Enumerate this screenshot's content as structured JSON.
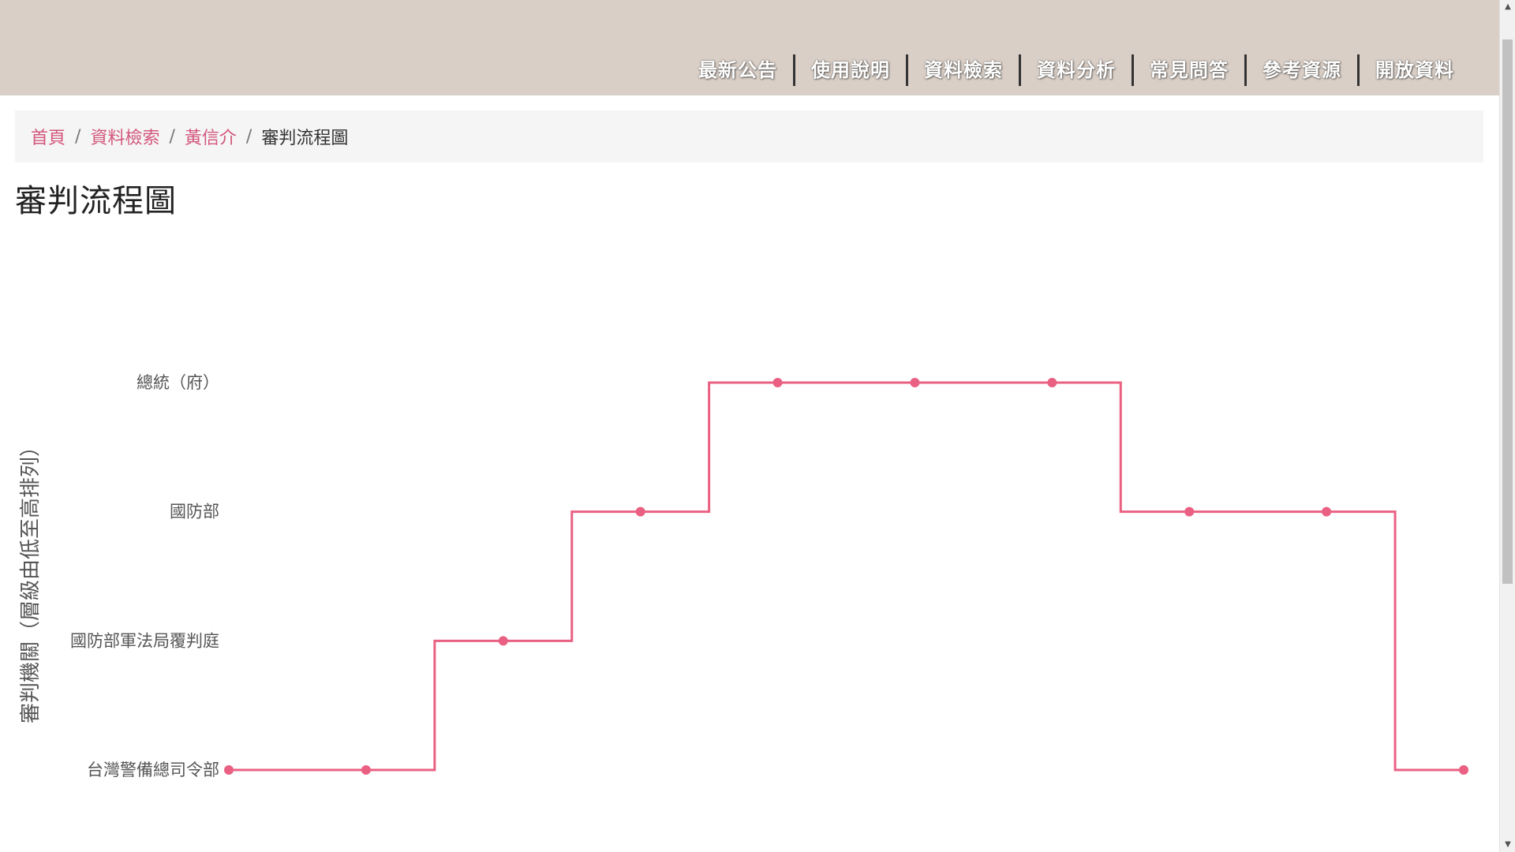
{
  "nav": {
    "items": [
      {
        "label": "最新公告"
      },
      {
        "label": "使用說明"
      },
      {
        "label": "資料檢索"
      },
      {
        "label": "資料分析"
      },
      {
        "label": "常見問答"
      },
      {
        "label": "參考資源"
      },
      {
        "label": "開放資料"
      }
    ]
  },
  "breadcrumb": {
    "home": "首頁",
    "search": "資料檢索",
    "person": "黃信介",
    "current": "審判流程圖",
    "separator": "/"
  },
  "page": {
    "title": "審判流程圖"
  },
  "colors": {
    "header_bg": "#d9cfc7",
    "accent": "#ea6083",
    "link": "#d3577d"
  },
  "chart_data": {
    "type": "line",
    "step": "middle",
    "ylabel": "審判機關（層級由低至高排列）",
    "xlabel": "",
    "y_categories": [
      "台灣警備總司令部",
      "國防部軍法局覆判庭",
      "國防部",
      "總統（府）"
    ],
    "x": [
      1,
      2,
      3,
      4,
      5,
      6,
      7,
      8,
      9,
      10
    ],
    "values": [
      "台灣警備總司令部",
      "台灣警備總司令部",
      "國防部軍法局覆判庭",
      "國防部",
      "總統（府）",
      "總統（府）",
      "總統（府）",
      "國防部",
      "國防部",
      "台灣警備總司令部"
    ],
    "color": "#ea6083",
    "grid": false,
    "legend": "none"
  }
}
